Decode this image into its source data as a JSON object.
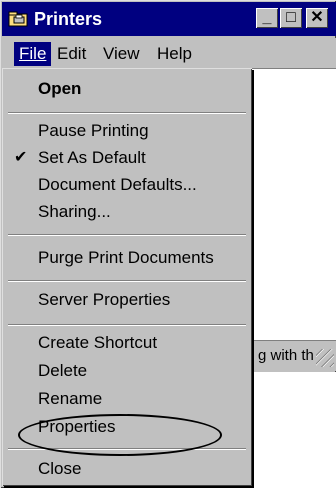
{
  "window": {
    "title": "Printers",
    "controls": {
      "minimize": "_",
      "maximize": "□",
      "close": "✕"
    }
  },
  "menubar": {
    "items": [
      "File",
      "Edit",
      "View",
      "Help"
    ]
  },
  "file_menu": {
    "open": "Open",
    "pause_printing": "Pause Printing",
    "set_as_default": "Set As Default",
    "document_defaults": "Document Defaults...",
    "sharing": "Sharing...",
    "purge": "Purge Print Documents",
    "server_properties": "Server Properties",
    "create_shortcut": "Create Shortcut",
    "delete": "Delete",
    "rename": "Rename",
    "properties": "Properties",
    "close": "Close"
  },
  "status": {
    "text": "g with th"
  }
}
